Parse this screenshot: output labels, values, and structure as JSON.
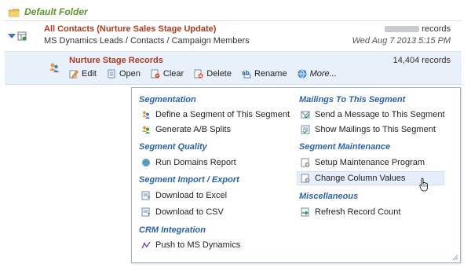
{
  "folder": {
    "title": "Default Folder"
  },
  "contacts": {
    "title": "All Contacts (Nurture Sales Stage Update)",
    "path": "MS Dynamics Leads / Contacts / Campaign Members",
    "records_suffix": "records",
    "date": "Wed Aug 7 2013 5:15 PM"
  },
  "nurture": {
    "title": "Nurture Stage Records",
    "records": "14,404 records"
  },
  "toolbar": {
    "edit": "Edit",
    "open": "Open",
    "clear": "Clear",
    "delete": "Delete",
    "rename": "Rename",
    "more": "More..."
  },
  "menu": {
    "segmentation": {
      "heading": "Segmentation",
      "items": [
        "Define a Segment of This Segment",
        "Generate A/B Splits"
      ]
    },
    "segment_quality": {
      "heading": "Segment Quality",
      "items": [
        "Run Domains Report"
      ]
    },
    "import_export": {
      "heading": "Segment Import / Export",
      "items": [
        "Download to Excel",
        "Download to CSV"
      ]
    },
    "crm": {
      "heading": "CRM Integration",
      "items": [
        "Push to MS Dynamics"
      ]
    },
    "mailings": {
      "heading": "Mailings To This Segment",
      "items": [
        "Send a Message to This Segment",
        "Show Mailings to This Segment"
      ]
    },
    "maintenance": {
      "heading": "Segment Maintenance",
      "items": [
        "Setup Maintenance Program",
        "Change Column Values"
      ]
    },
    "misc": {
      "heading": "Miscellaneous",
      "items": [
        "Refresh Record Count"
      ]
    }
  },
  "icons": {
    "folder": "folder-icon",
    "segment": "segment-people-icon",
    "edit": "pencil-icon",
    "open": "open-document-icon",
    "clear": "clear-icon",
    "delete": "delete-icon",
    "rename": "rename-icon",
    "more": "globe-icon"
  },
  "colors": {
    "folder_title": "#5a9a2a",
    "record_title": "#b23a1c",
    "section_heading": "#2a63b1",
    "selected_row": "#e8f0fa"
  }
}
